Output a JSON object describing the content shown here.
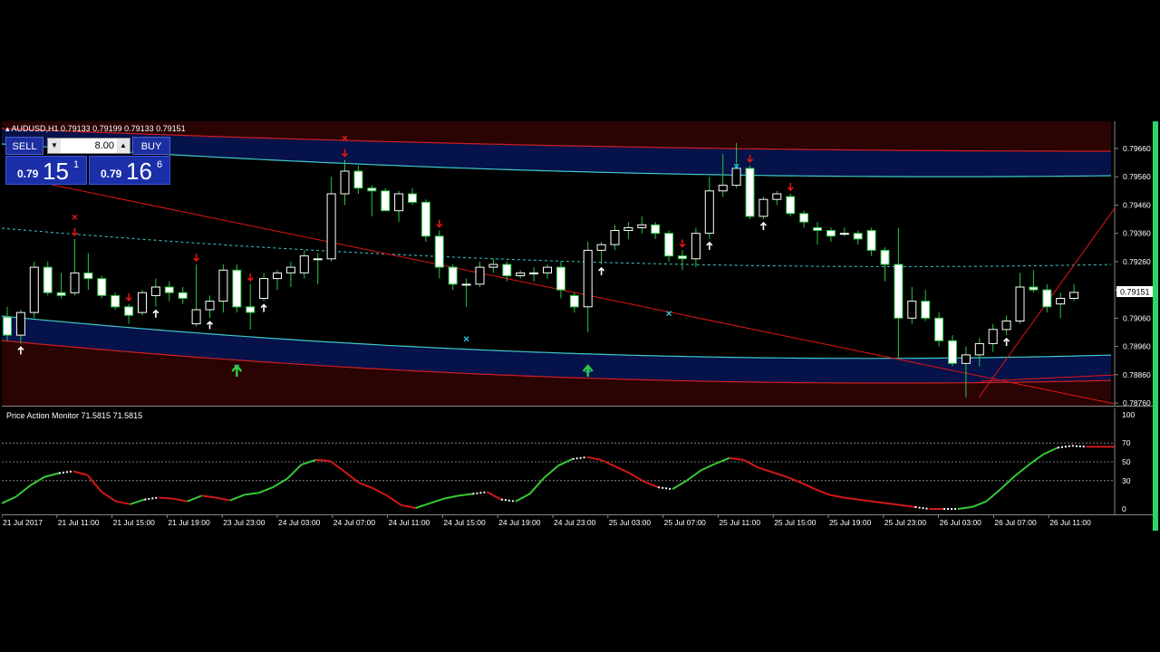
{
  "chart": {
    "symbol_line": "AUDUSD,H1  0.79133 0.79199 0.79133 0.79151",
    "current_price": "0.79151",
    "price_ticks": [
      "0.79660",
      "0.79560",
      "0.79460",
      "0.79360",
      "0.79260",
      "0.79160",
      "0.79060",
      "0.78960",
      "0.78860",
      "0.78760"
    ],
    "colors": {
      "up_candle": "#ffffff",
      "down_candle": "#ffffff",
      "wick": "#26c640",
      "band_fill_blue": "#06124a",
      "band_fill_red": "#2a0303",
      "band_line_cyan": "#3ec9c9",
      "band_line_red": "#d11f1f",
      "trend_line": "#e01616",
      "signal_up": "#ffffff",
      "signal_down": "#e01616",
      "signal_x": "#29b9d8",
      "big_arrow": "#2ecc40"
    },
    "icons": {
      "up_arrow": "up-arrow-icon",
      "down_arrow": "down-arrow-icon",
      "cross": "cross-marker-icon",
      "collapse": "collapse-triangle-icon"
    }
  },
  "ticket": {
    "sell_label": "SELL",
    "buy_label": "BUY",
    "lot": "8.00",
    "spin_down": "▼",
    "spin_up": "▲",
    "sell_small": "0.79",
    "sell_big": "15",
    "sell_sup": "1",
    "buy_small": "0.79",
    "buy_big": "16",
    "buy_sup": "6"
  },
  "oscillator": {
    "title": "Price Action Monitor 71.5815 71.5815",
    "levels": [
      "100",
      "70",
      "50",
      "30",
      "0"
    ],
    "values": [
      6,
      13,
      25,
      34,
      38,
      40,
      36,
      18,
      8,
      5,
      10,
      12,
      11,
      8,
      14,
      12,
      9,
      15,
      17,
      23,
      32,
      47,
      52,
      51,
      40,
      28,
      22,
      14,
      4,
      1,
      6,
      11,
      14,
      16,
      18,
      10,
      8,
      16,
      33,
      46,
      53,
      55,
      52,
      45,
      38,
      29,
      23,
      21,
      30,
      41,
      48,
      54,
      52,
      44,
      39,
      34,
      28,
      21,
      15,
      12,
      10,
      8,
      6,
      4,
      2,
      0,
      0,
      0,
      2,
      8,
      21,
      35,
      47,
      58,
      65,
      67,
      66,
      66,
      66
    ],
    "colors": {
      "rise": "#36c936",
      "fall": "#d21818",
      "dash": "#ffffff",
      "level_line": "#9a9a9a"
    }
  },
  "time_axis": {
    "labels": [
      "21 Jul 2017",
      "21 Jul 11:00",
      "21 Jul 15:00",
      "21 Jul 19:00",
      "23 Jul 23:00",
      "24 Jul 03:00",
      "24 Jul 07:00",
      "24 Jul 11:00",
      "24 Jul 15:00",
      "24 Jul 19:00",
      "24 Jul 23:00",
      "25 Jul 03:00",
      "25 Jul 07:00",
      "25 Jul 11:00",
      "25 Jul 15:00",
      "25 Jul 19:00",
      "25 Jul 23:00",
      "26 Jul 03:00",
      "26 Jul 07:00",
      "26 Jul 11:00"
    ]
  },
  "chart_data": {
    "type": "candlestick",
    "price_scale": [
      0.7876,
      0.7966
    ],
    "candles": [
      {
        "o": 0.79064,
        "h": 0.791,
        "l": 0.7898,
        "c": 0.79
      },
      {
        "o": 0.79,
        "h": 0.7909,
        "l": 0.7897,
        "c": 0.7908
      },
      {
        "o": 0.7908,
        "h": 0.7926,
        "l": 0.7906,
        "c": 0.7924
      },
      {
        "o": 0.7924,
        "h": 0.7926,
        "l": 0.7914,
        "c": 0.7915
      },
      {
        "o": 0.7915,
        "h": 0.7922,
        "l": 0.7913,
        "c": 0.7914
      },
      {
        "o": 0.7915,
        "h": 0.7934,
        "l": 0.7914,
        "c": 0.7922
      },
      {
        "o": 0.7922,
        "h": 0.7929,
        "l": 0.7916,
        "c": 0.792
      },
      {
        "o": 0.792,
        "h": 0.7921,
        "l": 0.7913,
        "c": 0.7914
      },
      {
        "o": 0.7914,
        "h": 0.7915,
        "l": 0.7909,
        "c": 0.791
      },
      {
        "o": 0.791,
        "h": 0.7911,
        "l": 0.7904,
        "c": 0.7907
      },
      {
        "o": 0.7908,
        "h": 0.7916,
        "l": 0.7907,
        "c": 0.7915
      },
      {
        "o": 0.7914,
        "h": 0.792,
        "l": 0.791,
        "c": 0.7917
      },
      {
        "o": 0.7917,
        "h": 0.7919,
        "l": 0.7912,
        "c": 0.7915
      },
      {
        "o": 0.7915,
        "h": 0.7917,
        "l": 0.7911,
        "c": 0.7913
      },
      {
        "o": 0.7904,
        "h": 0.7925,
        "l": 0.7903,
        "c": 0.7909
      },
      {
        "o": 0.7909,
        "h": 0.7914,
        "l": 0.7906,
        "c": 0.7912
      },
      {
        "o": 0.7912,
        "h": 0.7925,
        "l": 0.7908,
        "c": 0.7923
      },
      {
        "o": 0.7923,
        "h": 0.7925,
        "l": 0.7908,
        "c": 0.791
      },
      {
        "o": 0.791,
        "h": 0.7918,
        "l": 0.7902,
        "c": 0.7908
      },
      {
        "o": 0.7913,
        "h": 0.7922,
        "l": 0.7912,
        "c": 0.792
      },
      {
        "o": 0.792,
        "h": 0.7923,
        "l": 0.7916,
        "c": 0.7922
      },
      {
        "o": 0.7922,
        "h": 0.7926,
        "l": 0.7917,
        "c": 0.7924
      },
      {
        "o": 0.7922,
        "h": 0.793,
        "l": 0.792,
        "c": 0.7928
      },
      {
        "o": 0.7927,
        "h": 0.7929,
        "l": 0.7918,
        "c": 0.7927
      },
      {
        "o": 0.7927,
        "h": 0.7956,
        "l": 0.7926,
        "c": 0.795
      },
      {
        "o": 0.795,
        "h": 0.7962,
        "l": 0.7946,
        "c": 0.7958
      },
      {
        "o": 0.7958,
        "h": 0.796,
        "l": 0.795,
        "c": 0.7952
      },
      {
        "o": 0.7952,
        "h": 0.7953,
        "l": 0.7942,
        "c": 0.7951
      },
      {
        "o": 0.7951,
        "h": 0.7952,
        "l": 0.7944,
        "c": 0.7944
      },
      {
        "o": 0.7944,
        "h": 0.7951,
        "l": 0.794,
        "c": 0.795
      },
      {
        "o": 0.795,
        "h": 0.7952,
        "l": 0.7946,
        "c": 0.7947
      },
      {
        "o": 0.7947,
        "h": 0.7948,
        "l": 0.7933,
        "c": 0.7935
      },
      {
        "o": 0.7935,
        "h": 0.7937,
        "l": 0.792,
        "c": 0.7924
      },
      {
        "o": 0.7924,
        "h": 0.7925,
        "l": 0.7916,
        "c": 0.7918
      },
      {
        "o": 0.7918,
        "h": 0.792,
        "l": 0.791,
        "c": 0.7918
      },
      {
        "o": 0.7918,
        "h": 0.7926,
        "l": 0.7917,
        "c": 0.7924
      },
      {
        "o": 0.7924,
        "h": 0.7927,
        "l": 0.7922,
        "c": 0.7925
      },
      {
        "o": 0.7925,
        "h": 0.7926,
        "l": 0.7919,
        "c": 0.7921
      },
      {
        "o": 0.7921,
        "h": 0.7923,
        "l": 0.792,
        "c": 0.7922
      },
      {
        "o": 0.7922,
        "h": 0.7924,
        "l": 0.7919,
        "c": 0.7922
      },
      {
        "o": 0.7922,
        "h": 0.7925,
        "l": 0.792,
        "c": 0.7924
      },
      {
        "o": 0.7924,
        "h": 0.7926,
        "l": 0.7913,
        "c": 0.7916
      },
      {
        "o": 0.7914,
        "h": 0.7915,
        "l": 0.7908,
        "c": 0.791
      },
      {
        "o": 0.791,
        "h": 0.7933,
        "l": 0.7901,
        "c": 0.793
      },
      {
        "o": 0.793,
        "h": 0.7933,
        "l": 0.7925,
        "c": 0.7932
      },
      {
        "o": 0.7932,
        "h": 0.7939,
        "l": 0.793,
        "c": 0.7937
      },
      {
        "o": 0.7937,
        "h": 0.794,
        "l": 0.7934,
        "c": 0.7938
      },
      {
        "o": 0.7938,
        "h": 0.7942,
        "l": 0.7936,
        "c": 0.7939
      },
      {
        "o": 0.7939,
        "h": 0.794,
        "l": 0.7934,
        "c": 0.7936
      },
      {
        "o": 0.7936,
        "h": 0.7937,
        "l": 0.7926,
        "c": 0.7928
      },
      {
        "o": 0.7928,
        "h": 0.793,
        "l": 0.7923,
        "c": 0.7927
      },
      {
        "o": 0.7927,
        "h": 0.7938,
        "l": 0.7924,
        "c": 0.7936
      },
      {
        "o": 0.7936,
        "h": 0.7956,
        "l": 0.7934,
        "c": 0.7951
      },
      {
        "o": 0.7951,
        "h": 0.7964,
        "l": 0.7949,
        "c": 0.7953
      },
      {
        "o": 0.7953,
        "h": 0.7968,
        "l": 0.7952,
        "c": 0.7959
      },
      {
        "o": 0.7959,
        "h": 0.796,
        "l": 0.7941,
        "c": 0.7942
      },
      {
        "o": 0.7942,
        "h": 0.7949,
        "l": 0.7941,
        "c": 0.7948
      },
      {
        "o": 0.7948,
        "h": 0.7951,
        "l": 0.7946,
        "c": 0.795
      },
      {
        "o": 0.7949,
        "h": 0.795,
        "l": 0.7942,
        "c": 0.7943
      },
      {
        "o": 0.7943,
        "h": 0.7944,
        "l": 0.7938,
        "c": 0.794
      },
      {
        "o": 0.7938,
        "h": 0.794,
        "l": 0.7932,
        "c": 0.7937
      },
      {
        "o": 0.7937,
        "h": 0.7938,
        "l": 0.7933,
        "c": 0.7935
      },
      {
        "o": 0.7936,
        "h": 0.7938,
        "l": 0.7935,
        "c": 0.7936
      },
      {
        "o": 0.7936,
        "h": 0.7937,
        "l": 0.7932,
        "c": 0.7934
      },
      {
        "o": 0.7937,
        "h": 0.7938,
        "l": 0.7928,
        "c": 0.793
      },
      {
        "o": 0.793,
        "h": 0.7931,
        "l": 0.7919,
        "c": 0.7925
      },
      {
        "o": 0.7925,
        "h": 0.7938,
        "l": 0.7892,
        "c": 0.7906
      },
      {
        "o": 0.7906,
        "h": 0.7917,
        "l": 0.7904,
        "c": 0.7912
      },
      {
        "o": 0.7912,
        "h": 0.7916,
        "l": 0.7905,
        "c": 0.7906
      },
      {
        "o": 0.7906,
        "h": 0.7908,
        "l": 0.7896,
        "c": 0.7898
      },
      {
        "o": 0.7898,
        "h": 0.79,
        "l": 0.7889,
        "c": 0.789
      },
      {
        "o": 0.789,
        "h": 0.7896,
        "l": 0.7878,
        "c": 0.7893
      },
      {
        "o": 0.7893,
        "h": 0.7899,
        "l": 0.7889,
        "c": 0.7897
      },
      {
        "o": 0.7897,
        "h": 0.7904,
        "l": 0.7894,
        "c": 0.7902
      },
      {
        "o": 0.7902,
        "h": 0.7907,
        "l": 0.79,
        "c": 0.7905
      },
      {
        "o": 0.7905,
        "h": 0.7922,
        "l": 0.7904,
        "c": 0.7917
      },
      {
        "o": 0.7917,
        "h": 0.7923,
        "l": 0.7915,
        "c": 0.7916
      },
      {
        "o": 0.7916,
        "h": 0.7918,
        "l": 0.7908,
        "c": 0.791
      },
      {
        "o": 0.7911,
        "h": 0.7915,
        "l": 0.7906,
        "c": 0.7913
      },
      {
        "o": 0.7913,
        "h": 0.7918,
        "l": 0.7912,
        "c": 0.79151
      }
    ],
    "signals": [
      {
        "i": 1,
        "type": "up"
      },
      {
        "i": 5,
        "type": "down_x"
      },
      {
        "i": 9,
        "type": "down"
      },
      {
        "i": 11,
        "type": "up"
      },
      {
        "i": 14,
        "type": "down"
      },
      {
        "i": 15,
        "type": "up"
      },
      {
        "i": 18,
        "type": "down"
      },
      {
        "i": 19,
        "type": "up"
      },
      {
        "i": 25,
        "type": "down_x"
      },
      {
        "i": 32,
        "type": "down"
      },
      {
        "i": 44,
        "type": "up"
      },
      {
        "i": 50,
        "type": "down"
      },
      {
        "i": 52,
        "type": "up"
      },
      {
        "i": 55,
        "type": "down"
      },
      {
        "i": 56,
        "type": "up"
      },
      {
        "i": 58,
        "type": "down"
      },
      {
        "i": 74,
        "type": "up"
      }
    ],
    "cross_markers": [
      {
        "i": 17,
        "price": 0.7897
      },
      {
        "i": 34,
        "price": 0.7907
      },
      {
        "i": 43,
        "price": 0.7896
      },
      {
        "i": 49,
        "price": 0.7916
      },
      {
        "i": 54,
        "price": 0.7968
      }
    ],
    "big_arrows": [
      {
        "i": 17
      },
      {
        "i": 43
      }
    ]
  }
}
